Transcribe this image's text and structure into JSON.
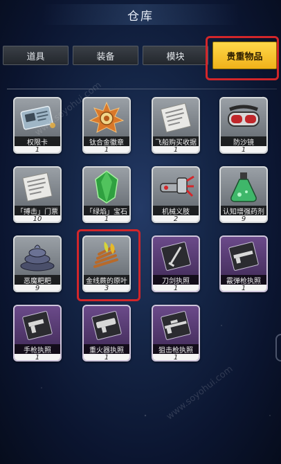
{
  "window": {
    "title": "仓库"
  },
  "tabs": [
    {
      "label": "道具",
      "active": false
    },
    {
      "label": "装备",
      "active": false
    },
    {
      "label": "模块",
      "active": false
    },
    {
      "label": "贵重物品",
      "active": true
    }
  ],
  "items": [
    {
      "name": "权限卡",
      "count": "1",
      "icon": "keycard-icon",
      "rarity": "gray"
    },
    {
      "name": "钛合金徽章",
      "count": "1",
      "icon": "badge-icon",
      "rarity": "gray"
    },
    {
      "name": "飞船购买收据",
      "count": "1",
      "icon": "receipt-icon",
      "rarity": "gray"
    },
    {
      "name": "防沙镜",
      "count": "1",
      "icon": "goggles-icon",
      "rarity": "gray"
    },
    {
      "name": "「搏击」门票",
      "count": "10",
      "icon": "ticket-icon",
      "rarity": "gray"
    },
    {
      "name": "「绿焰」宝石",
      "count": "1",
      "icon": "gem-icon",
      "rarity": "gray"
    },
    {
      "name": "机械义肢",
      "count": "2",
      "icon": "mech-arm-icon",
      "rarity": "gray"
    },
    {
      "name": "认知增强药剂",
      "count": "9",
      "icon": "potion-icon",
      "rarity": "gray"
    },
    {
      "name": "恶魔粑粑",
      "count": "9",
      "icon": "poop-icon",
      "rarity": "gray"
    },
    {
      "name": "金线蕨的原叶",
      "count": "3",
      "icon": "fern-leaf-icon",
      "rarity": "gray"
    },
    {
      "name": "刀剑执照",
      "count": "1",
      "icon": "sword-license-icon",
      "rarity": "purple"
    },
    {
      "name": "霰弹枪执照",
      "count": "1",
      "icon": "shotgun-license-icon",
      "rarity": "purple"
    },
    {
      "name": "手枪执照",
      "count": "1",
      "icon": "pistol-license-icon",
      "rarity": "purple"
    },
    {
      "name": "重火器执照",
      "count": "1",
      "icon": "heavy-weapon-license-icon",
      "rarity": "purple"
    },
    {
      "name": "狙击枪执照",
      "count": "1",
      "icon": "sniper-license-icon",
      "rarity": "purple"
    }
  ],
  "colors": {
    "tab_active": "#f5c22e",
    "highlight": "#d3262a",
    "card_gray": "#7a8087",
    "card_purple": "#4e3468"
  },
  "watermark": {
    "text": "www.soyohui.com"
  }
}
